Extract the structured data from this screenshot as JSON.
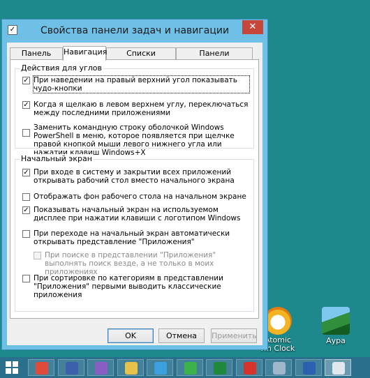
{
  "window": {
    "title": "Свойства панели задач и навигации",
    "close_glyph": "✕"
  },
  "tabs": [
    {
      "label": "Панель задач",
      "active": false
    },
    {
      "label": "Навигация",
      "active": true
    },
    {
      "label": "Списки переходов",
      "active": false
    },
    {
      "label": "Панели инструментов",
      "active": false
    }
  ],
  "corners": {
    "label": "Действия для углов",
    "options": [
      {
        "text": "При наведении на правый верхний угол показывать чудо-кнопки",
        "checked": true
      },
      {
        "text": "Когда я щелкаю в левом верхнем углу, переключаться между последними приложениями",
        "checked": true
      },
      {
        "text": "Заменить командную строку оболочкой Windows PowerShell в меню, которое появляется при щелчке правой кнопкой мыши левого нижнего угла или нажатии клавиш Windows+X",
        "checked": false
      }
    ]
  },
  "start": {
    "label": "Начальный экран",
    "options": [
      {
        "text": "При входе в систему и закрытии всех приложений открывать рабочий стол вместо начального экрана",
        "checked": true
      },
      {
        "text": "Отображать фон рабочего стола на начальном экране",
        "checked": false
      },
      {
        "text": "Показывать начальный экран на используемом дисплее при нажатии клавиши с логотипом Windows",
        "checked": true
      },
      {
        "text": "При переходе на начальный экран автоматически открывать представление \"Приложения\"",
        "checked": false
      },
      {
        "text": "При поиске в представлении \"Приложения\" выполнять поиск везде, а не только в моих приложениях",
        "checked": false,
        "disabled": true
      },
      {
        "text": "При сортировке по категориям в представлении \"Приложения\" первыми выводить классические приложения",
        "checked": false
      }
    ]
  },
  "buttons": {
    "ok": "OK",
    "cancel": "Отмена",
    "apply": "Применить"
  },
  "desktop_icons": [
    {
      "label": "Atomic\nrm Clock",
      "icon": "alarm-clock-icon"
    },
    {
      "label": "Аура",
      "icon": "aura-icon"
    }
  ],
  "taskbar": {
    "items": [
      {
        "name": "chrome-icon",
        "color": "#e04a3a"
      },
      {
        "name": "save-disk-icon",
        "color": "#3b5fa8"
      },
      {
        "name": "visual-studio-icon",
        "color": "#8a5fc4"
      },
      {
        "name": "explorer-folder-icon",
        "color": "#e8c14a"
      },
      {
        "name": "internet-explorer-icon",
        "color": "#3aa0e0"
      },
      {
        "name": "green-app-icon",
        "color": "#3bb24a"
      },
      {
        "name": "excel-icon",
        "color": "#1f8a3c"
      },
      {
        "name": "pdf-icon",
        "color": "#d8332b"
      },
      {
        "name": "window-app-icon",
        "color": "#9fb7c8"
      },
      {
        "name": "word-icon",
        "color": "#2b5fb0"
      },
      {
        "name": "taskbar-properties-icon",
        "color": "#dfe8ef"
      }
    ]
  },
  "colors": {
    "desktop": "#1e898c",
    "title_bar": "#6ec0e6",
    "close_button": "#c7463b",
    "taskbar": "#2a6f8c"
  }
}
